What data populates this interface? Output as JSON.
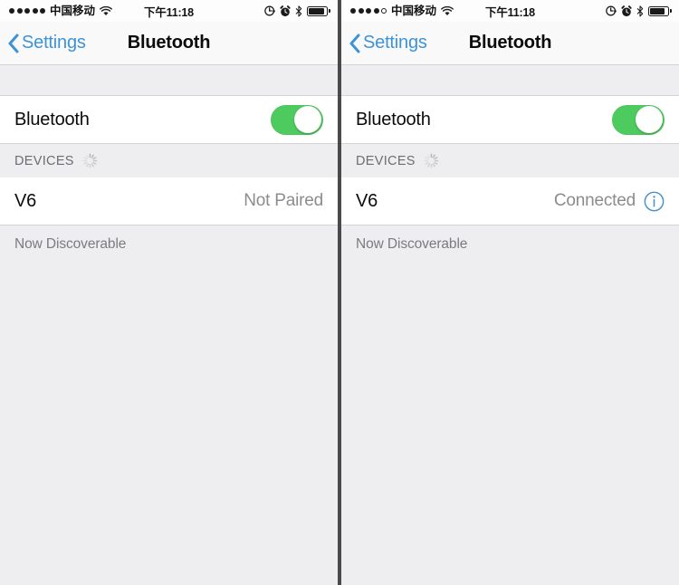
{
  "screens": [
    {
      "id": "left",
      "status_bar": {
        "signal_dots_filled": 5,
        "signal_dots_total": 5,
        "carrier": "中国移动",
        "wifi_icon": "wifi-icon",
        "time": "下午11:18",
        "location_icon": "location-icon",
        "alarm_icon": "alarm-clock-icon",
        "bluetooth_icon": "bluetooth-icon",
        "battery_icon": "battery-icon",
        "battery_level_percent": 88
      },
      "nav_bar": {
        "back_icon": "chevron-left-icon",
        "back_label": "Settings",
        "title": "Bluetooth"
      },
      "bluetooth_row": {
        "label": "Bluetooth",
        "toggle_state": "on",
        "toggle_on_color": "#4ecb5e"
      },
      "devices_section": {
        "header": "DEVICES",
        "spinner_icon": "loading-spinner-icon",
        "device": {
          "name": "V6",
          "status": "Not Paired",
          "has_info_button": false,
          "info_icon": ""
        }
      },
      "footnote": "Now Discoverable"
    },
    {
      "id": "right",
      "status_bar": {
        "signal_dots_filled": 4,
        "signal_dots_total": 5,
        "carrier": "中国移动",
        "wifi_icon": "wifi-icon",
        "time": "下午11:18",
        "location_icon": "location-icon",
        "alarm_icon": "alarm-clock-icon",
        "bluetooth_icon": "bluetooth-icon",
        "battery_icon": "battery-icon",
        "battery_level_percent": 82
      },
      "nav_bar": {
        "back_icon": "chevron-left-icon",
        "back_label": "Settings",
        "title": "Bluetooth"
      },
      "bluetooth_row": {
        "label": "Bluetooth",
        "toggle_state": "on",
        "toggle_on_color": "#4ecb5e"
      },
      "devices_section": {
        "header": "DEVICES",
        "spinner_icon": "loading-spinner-icon",
        "device": {
          "name": "V6",
          "status": "Connected",
          "has_info_button": true,
          "info_icon": "info-circle-icon"
        }
      },
      "footnote": "Now Discoverable"
    }
  ],
  "colors": {
    "accent_blue": "#3e93d6",
    "toggle_green": "#4ecb5e",
    "info_blue": "#4a90c8",
    "page_background": "#eeeef0",
    "row_background": "#ffffff",
    "secondary_text": "#8c8c90",
    "separator": "#d4d4d6"
  }
}
